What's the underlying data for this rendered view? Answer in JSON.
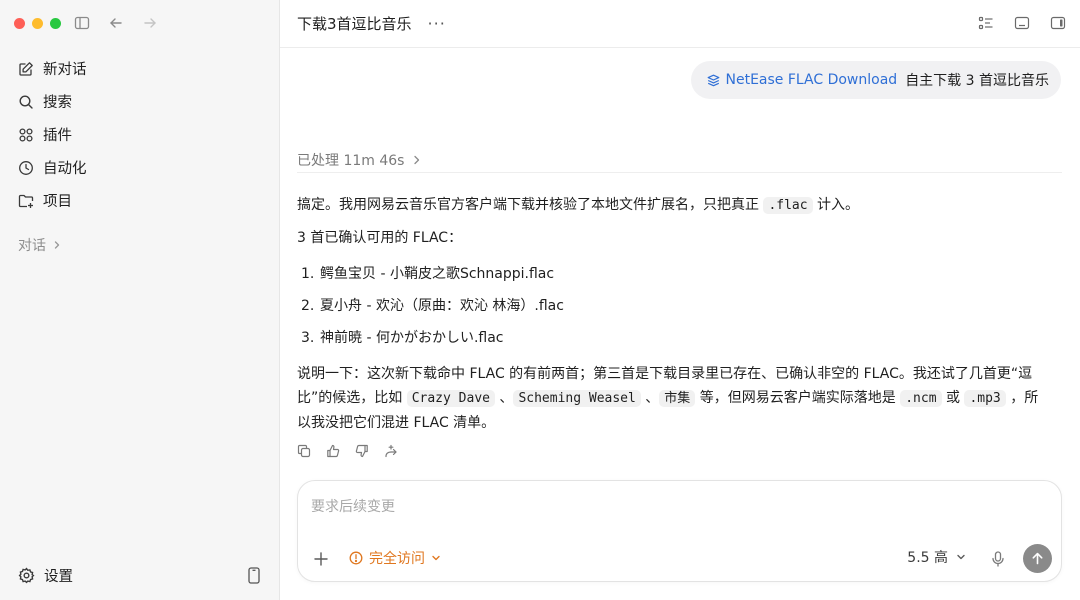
{
  "sidebar": {
    "items": [
      {
        "label": "新对话",
        "icon": "edit-icon"
      },
      {
        "label": "搜索",
        "icon": "search-icon"
      },
      {
        "label": "插件",
        "icon": "grid-icon"
      },
      {
        "label": "自动化",
        "icon": "clock-icon"
      },
      {
        "label": "项目",
        "icon": "folder-plus-icon"
      }
    ],
    "section_label": "对话",
    "settings_label": "设置"
  },
  "header": {
    "title": "下载3首逗比音乐",
    "more": "···"
  },
  "conversation": {
    "user_message": {
      "skill": "NetEase FLAC Download",
      "text": "自主下载 3 首逗比音乐"
    },
    "processed": "已处理 11m 46s",
    "answer": {
      "intro_before": "搞定。我用网易云音乐官方客户端下载并核验了本地文件扩展名，只把真正 ",
      "intro_code": ".flac",
      "intro_after": " 计入。",
      "subtitle": "3 首已确认可用的 FLAC：",
      "items": [
        "鳄鱼宝贝 - 小鞘皮之歌Schnappi.flac",
        "夏小舟 - 欢沁（原曲：欢沁 林海）.flac",
        "神前暁 - 何かがおかしい.flac"
      ],
      "note_part1": "说明一下：这次新下载命中 FLAC 的有前两首；第三首是下载目录里已存在、已确认非空的 FLAC。我还试了几首更“逗比”的候选，比如 ",
      "note_code1": "Crazy Dave",
      "note_sep1": " 、",
      "note_code2": "Scheming Weasel",
      "note_sep2": " 、",
      "note_code3": "市集",
      "note_part2": " 等，但网易云客户端实际落地是 ",
      "note_code4": ".ncm",
      "note_part3": " 或 ",
      "note_code5": ".mp3",
      "note_part4": " ，所以我没把它们混进 FLAC 清单。"
    }
  },
  "composer": {
    "placeholder": "要求后续变更",
    "access_label": "完全访问",
    "model_label": "5.5 高"
  },
  "colors": {
    "accent_link": "#2f6fd6",
    "warning": "#e0771f",
    "sidebar_bg": "#f6f6f6"
  }
}
